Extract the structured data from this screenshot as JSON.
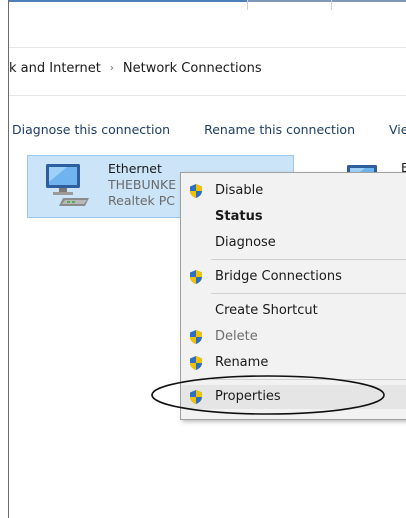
{
  "breadcrumb": {
    "items": [
      "k and Internet",
      "Network Connections"
    ],
    "separator": "›"
  },
  "command_bar": {
    "items": [
      "Diagnose this connection",
      "Rename this connection",
      "Vie"
    ]
  },
  "adapter_selected": {
    "name": "Ethernet",
    "network": "THEBUNKE",
    "device": "Realtek PC"
  },
  "adapter_other": {
    "name": "E"
  },
  "context_menu": {
    "items": [
      {
        "label": "Disable",
        "shield": true,
        "bold": false,
        "disabled": false
      },
      {
        "label": "Status",
        "shield": false,
        "bold": true,
        "disabled": false
      },
      {
        "label": "Diagnose",
        "shield": false,
        "bold": false,
        "disabled": false
      },
      {
        "label": "Bridge Connections",
        "shield": true,
        "bold": false,
        "disabled": false
      },
      {
        "label": "Create Shortcut",
        "shield": false,
        "bold": false,
        "disabled": false
      },
      {
        "label": "Delete",
        "shield": true,
        "bold": false,
        "disabled": true
      },
      {
        "label": "Rename",
        "shield": true,
        "bold": false,
        "disabled": false
      },
      {
        "label": "Properties",
        "shield": true,
        "bold": false,
        "disabled": false,
        "highlighted": true
      }
    ]
  },
  "colors": {
    "selection_fill": "#cce4f7",
    "selection_border": "#99c9ef",
    "link_text": "#1f3e66",
    "menu_background": "#f2f2f2",
    "shield_blue": "#2f6fbf",
    "shield_yellow": "#f2c200"
  }
}
